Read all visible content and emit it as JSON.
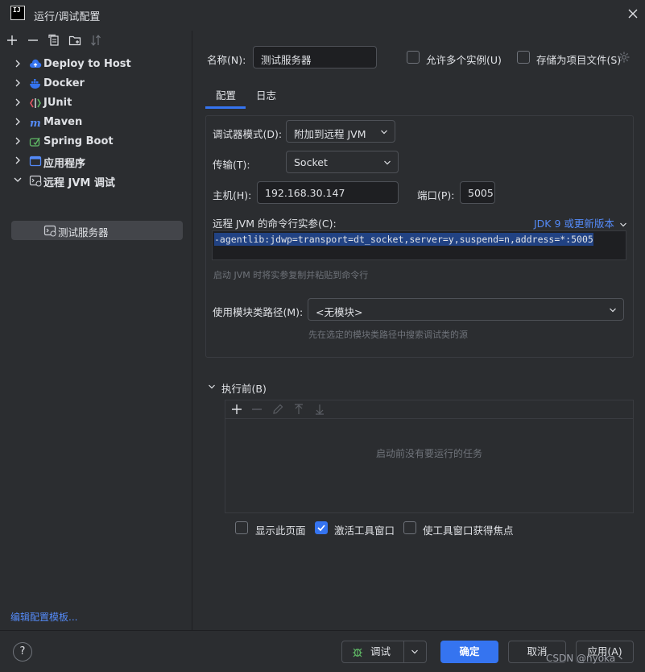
{
  "window": {
    "logo_text": "IJ",
    "title": "运行/调试配置"
  },
  "tree": {
    "items": [
      {
        "label": "Deploy to Host",
        "icon": "cloud-upload-icon"
      },
      {
        "label": "Docker",
        "icon": "docker-icon"
      },
      {
        "label": "JUnit",
        "icon": "junit-icon"
      },
      {
        "label": "Maven",
        "icon": "maven-icon"
      },
      {
        "label": "Spring Boot",
        "icon": "spring-boot-icon"
      },
      {
        "label": "应用程序",
        "icon": "application-icon"
      },
      {
        "label": "远程 JVM 调试",
        "icon": "remote-jvm-icon"
      }
    ],
    "selected_child": "测试服务器",
    "edit_templates": "编辑配置模板..."
  },
  "form": {
    "name_label": "名称(N):",
    "name_value": "测试服务器",
    "allow_multiple": "允许多个实例(U)",
    "store_as_file": "存储为项目文件(S)",
    "tabs": [
      "配置",
      "日志"
    ],
    "debugger_mode_label": "调试器模式(D):",
    "debugger_mode_value": "附加到远程 JVM",
    "transport_label": "传输(T):",
    "transport_value": "Socket",
    "host_label": "主机(H):",
    "host_value": "192.168.30.147",
    "port_label": "端口(P):",
    "port_value": "5005",
    "cmd_label": "远程 JVM 的命令行实参(C):",
    "jdk_link": "JDK 9 或更新版本",
    "cmd_value": "-agentlib:jdwp=transport=dt_socket,server=y,suspend=n,address=*:5005",
    "cmd_hint": "启动 JVM 时将实参复制并粘贴到命令行",
    "module_label": "使用模块类路径(M):",
    "module_value": "<无模块>",
    "module_hint": "先在选定的模块类路径中搜索调试类的源",
    "before_launch_label": "执行前(B)",
    "before_launch_empty": "启动前没有要运行的任务",
    "show_page": "显示此页面",
    "activate_tool_window": "激活工具窗口",
    "focus_tool_window": "使工具窗口获得焦点",
    "activate_checked": true
  },
  "footer": {
    "help": "?",
    "debug": "调试",
    "ok": "确定",
    "cancel": "取消",
    "apply": "应用(A)",
    "watermark": "CSDN @nyoka丶"
  },
  "colors": {
    "accent": "#3574f0",
    "link": "#548af7",
    "background": "#2b2d30"
  }
}
